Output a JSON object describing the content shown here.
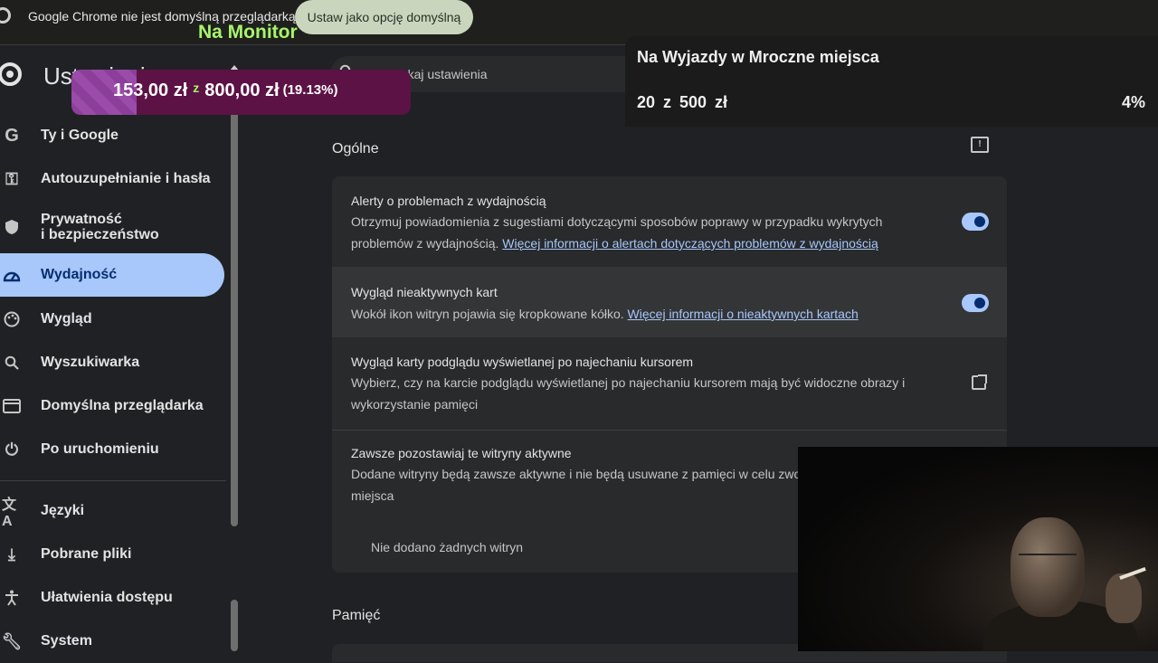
{
  "infobar": {
    "message": "Google Chrome nie jest domyślną przeglądarką",
    "button": "Ustaw jako opcję domyślną"
  },
  "overlay": {
    "monitor_label": "Na Monitor",
    "donation": {
      "current": "153,00 zł",
      "separator": "z",
      "target": "800,00 zł",
      "percent": "(19.13%)",
      "progress": 0.1913
    },
    "goal": {
      "title": "Na Wyjazdy w Mroczne miejsca",
      "value": "20 z 500 zł",
      "percent": "4%"
    }
  },
  "sidebar": {
    "title": "Ustawienia",
    "items": [
      {
        "label": "Ty i Google",
        "icon": "google-icon"
      },
      {
        "label": "Autouzupełnianie i hasła",
        "icon": "key-icon"
      },
      {
        "label": "Prywatność\ni bezpieczeństwo",
        "icon": "shield-icon"
      },
      {
        "label": "Wydajność",
        "icon": "speedometer-icon",
        "active": true
      },
      {
        "label": "Wygląd",
        "icon": "palette-icon"
      },
      {
        "label": "Wyszukiwarka",
        "icon": "search-icon"
      },
      {
        "label": "Domyślna przeglądarka",
        "icon": "browser-icon"
      },
      {
        "label": "Po uruchomieniu",
        "icon": "power-icon"
      },
      {
        "label": "Języki",
        "icon": "translate-icon"
      },
      {
        "label": "Pobrane pliki",
        "icon": "download-icon"
      },
      {
        "label": "Ułatwienia dostępu",
        "icon": "accessibility-icon"
      },
      {
        "label": "System",
        "icon": "wrench-icon"
      }
    ]
  },
  "search": {
    "placeholder": "Przeszukaj ustawienia"
  },
  "main": {
    "section_general": "Ogólne",
    "section_memory": "Pamięć",
    "rows": [
      {
        "title": "Alerty o problemach z wydajnością",
        "desc": "Otrzymuj powiadomienia z sugestiami dotyczącymi sposobów poprawy w przypadku wykrytych problemów z wydajnością.",
        "link": "Więcej informacji o alertach dotyczących problemów z wydajnością",
        "toggle": true
      },
      {
        "title": "Wygląd nieaktywnych kart",
        "desc": "Wokół ikon witryn pojawia się kropkowane kółko.",
        "link": "Więcej informacji o nieaktywnych kartach",
        "toggle": true
      },
      {
        "title": "Wygląd karty podglądu wyświetlanej po najechaniu kursorem",
        "desc": "Wybierz, czy na karcie podglądu wyświetlanej po najechaniu kursorem mają być widoczne obrazy i wykorzystanie pamięci"
      },
      {
        "title": "Zawsze pozostawiaj te witryny aktywne",
        "desc": "Dodane witryny będą zawsze aktywne i nie będą usuwane z pamięci w celu zwo miejsca"
      }
    ],
    "no_sites": "Nie dodano żadnych witryn"
  }
}
